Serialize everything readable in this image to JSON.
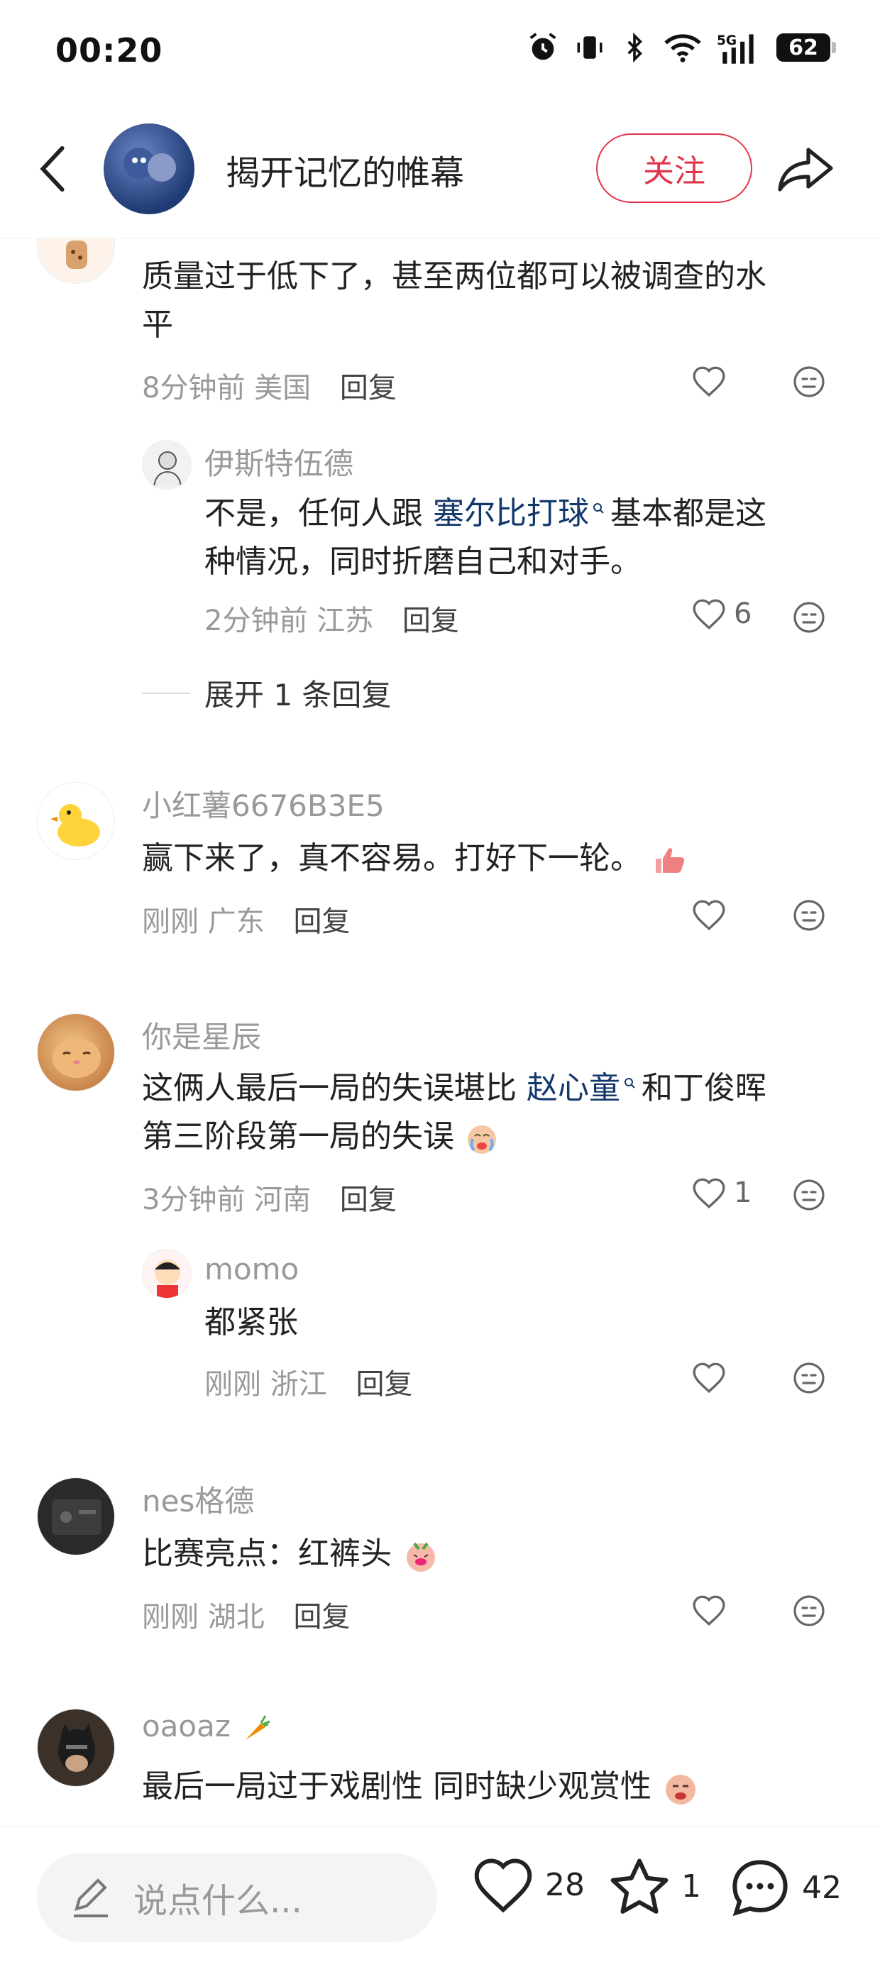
{
  "status_bar": {
    "time": "00:20",
    "battery": "62"
  },
  "header": {
    "title": "揭开记忆的帷幕",
    "follow_label": "关注"
  },
  "comments": [
    {
      "text_line1": "质量过于低下了，甚至两位都可以被调查的水",
      "text_line2": "平",
      "time": "8分钟前",
      "location": "美国",
      "reply_label": "回复",
      "replies": [
        {
          "username": "伊斯特伍德",
          "text_pre": "不是，任何人跟",
          "link": "塞尔比打球",
          "text_post": "基本都是这",
          "text_line2": "种情况，同时折磨自己和对手。",
          "time": "2分钟前",
          "location": "江苏",
          "reply_label": "回复",
          "likes": "6"
        }
      ],
      "expand_label": "展开 1 条回复"
    },
    {
      "username": "小红薯6676B3E5",
      "text": "赢下来了，真不容易。打好下一轮。",
      "time": "刚刚",
      "location": "广东",
      "reply_label": "回复"
    },
    {
      "username": "你是星辰",
      "text_pre": "这俩人最后一局的失误堪比",
      "link": "赵心童",
      "text_post": "和丁俊晖",
      "text_line2": "第三阶段第一局的失误",
      "time": "3分钟前",
      "location": "河南",
      "reply_label": "回复",
      "likes": "1",
      "replies": [
        {
          "username": "momo",
          "text": "都紧张",
          "time": "刚刚",
          "location": "浙江",
          "reply_label": "回复"
        }
      ]
    },
    {
      "username": "nes格德",
      "text": "比赛亮点：红裤头",
      "time": "刚刚",
      "location": "湖北",
      "reply_label": "回复"
    },
    {
      "username": "oaoaz",
      "text": "最后一局过于戏剧性 同时缺少观赏性"
    }
  ],
  "bottom_bar": {
    "input_placeholder": "说点什么...",
    "likes": "28",
    "stars": "1",
    "comments": "42"
  },
  "colors": {
    "accent": "#e3334b",
    "link": "#13386c",
    "meta": "#999999"
  }
}
